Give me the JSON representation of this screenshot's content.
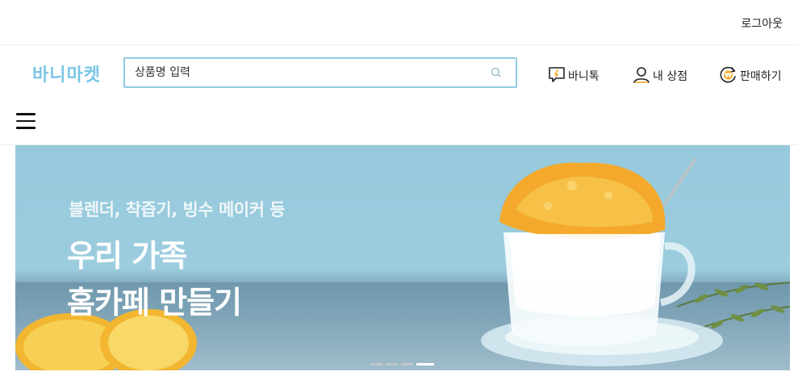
{
  "topbar": {
    "logout_label": "로그아웃"
  },
  "header": {
    "logo": "바니마켓",
    "search": {
      "placeholder": "상품명 입력",
      "value": ""
    },
    "nav": {
      "talk_label": "바니톡",
      "store_label": "내 상점",
      "sell_label": "판매하기"
    }
  },
  "menu": {
    "icon": "hamburger-menu-icon"
  },
  "banner": {
    "subtitle": "블렌더, 착즙기, 빙수 메이커 등",
    "title_line1": "우리 가족",
    "title_line2": "홈카페 만들기",
    "slide_count": 4,
    "active_slide": 4
  },
  "colors": {
    "brand": "#7cc6e6",
    "search_border": "#8fcbe2",
    "sell_icon_accent": "#f5a623"
  }
}
